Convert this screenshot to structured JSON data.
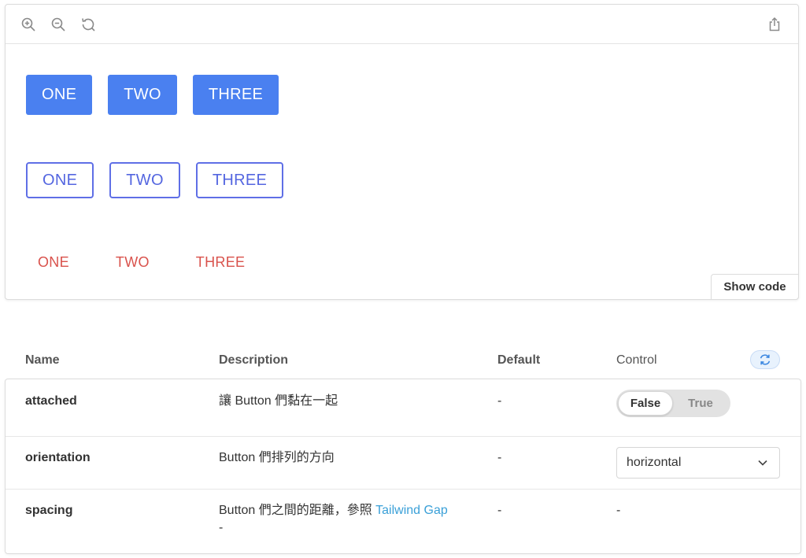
{
  "toolbar": {
    "zoom_in": "zoom-in-icon",
    "zoom_out": "zoom-out-icon",
    "reset_zoom": "refresh-icon",
    "share": "share-icon"
  },
  "preview": {
    "solid_buttons": [
      "ONE",
      "TWO",
      "THREE"
    ],
    "outline_buttons": [
      "ONE",
      "TWO",
      "THREE"
    ],
    "ghost_buttons": [
      "ONE",
      "TWO",
      "THREE"
    ],
    "show_code_label": "Show code"
  },
  "table": {
    "headers": {
      "name": "Name",
      "description": "Description",
      "default": "Default",
      "control": "Control"
    },
    "rows": [
      {
        "name": "attached",
        "description": "讓 Button 們黏在一起",
        "default": "-",
        "control": {
          "type": "toggle",
          "options": [
            "False",
            "True"
          ],
          "selected": "False"
        }
      },
      {
        "name": "orientation",
        "description": "Button 們排列的方向",
        "default": "-",
        "control": {
          "type": "select",
          "value": "horizontal"
        }
      },
      {
        "name": "spacing",
        "description_prefix": "Button 們之間的距離，參照 ",
        "description_link": "Tailwind Gap",
        "description_suffix": "-",
        "default": "-",
        "control": {
          "type": "none",
          "value": "-"
        }
      }
    ]
  },
  "colors": {
    "solid_bg": "#4a80f0",
    "outline": "#5f6fe6",
    "ghost_text": "#d9524c",
    "link": "#3aa0d8",
    "reset_bg": "#e8f2fd"
  }
}
